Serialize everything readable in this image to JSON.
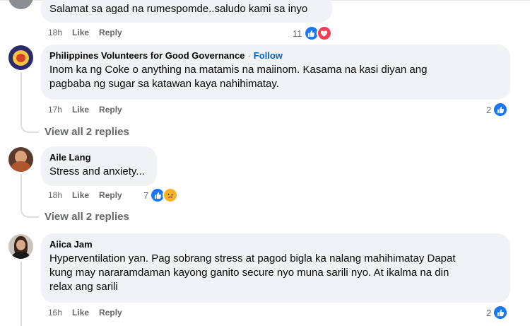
{
  "comments": [
    {
      "author": "",
      "text": "Salamat sa agad na rumespomde..saludo kami sa inyo",
      "time": "18h",
      "like_label": "Like",
      "reply_label": "Reply",
      "reaction_count": "11",
      "reaction_icons": [
        "like-icon",
        "love-icon"
      ]
    },
    {
      "author": "Philippines Volunteers for Good Governance",
      "separator": "·",
      "follow_label": "Follow",
      "text_lines": [
        "Inom ka ng Coke o anything na matamis na maiinom. Kasama na kasi diyan ang",
        "pagbaba ng sugar sa katawan kaya nahihimatay."
      ],
      "time": "17h",
      "like_label": "Like",
      "reply_label": "Reply",
      "reaction_count": "2",
      "reaction_icons": [
        "like-icon"
      ],
      "view_replies": "View all 2 replies"
    },
    {
      "author": "Aile Lang",
      "text": "Stress and anxiety...",
      "time": "18h",
      "like_label": "Like",
      "reply_label": "Reply",
      "reaction_count": "7",
      "reaction_icons": [
        "like-icon",
        "sad-icon"
      ],
      "view_replies": "View all 2 replies"
    },
    {
      "author": "Aiica Jam",
      "text_lines": [
        "Hyperventilation yan. Pag sobrang stress at pagod bigla ka nalang mahihimatay Dapat",
        "kung may nararamdaman kayong ganito secure nyo muna sarili nyo. At ikalma na din",
        "relax ang sarili"
      ],
      "time": "16h",
      "like_label": "Like",
      "reply_label": "Reply",
      "reaction_count": "2",
      "reaction_icons": [
        "like-icon"
      ]
    }
  ],
  "colors": {
    "bubble": "#f0f2f5",
    "meta_text": "#65676b",
    "follow": "#0064d1",
    "like": "#1877f2",
    "love": "#f33e58",
    "sad": "#f7b125"
  }
}
